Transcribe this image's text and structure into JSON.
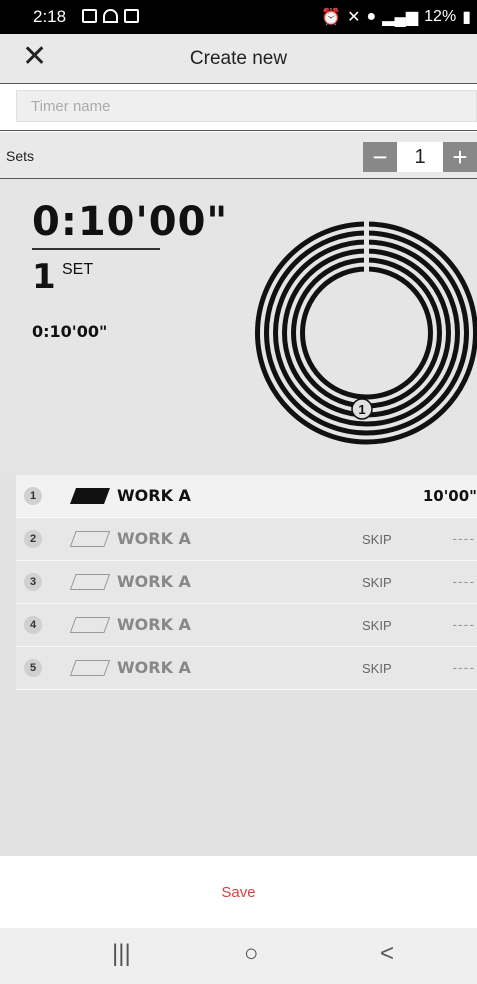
{
  "status_bar": {
    "time": "2:18",
    "battery": "12%"
  },
  "header": {
    "close_glyph": "✕",
    "title": "Create new"
  },
  "timer_name": {
    "placeholder": "Timer name",
    "value": ""
  },
  "sets": {
    "label": "Sets",
    "minus": "−",
    "value": "1",
    "plus": "+"
  },
  "summary": {
    "total_time": "0:10'00\"",
    "set_count": "1",
    "set_word": "SET",
    "set_time": "0:10'00\"",
    "ring_marker": "1"
  },
  "intervals": [
    {
      "num": "1",
      "name": "WORK A",
      "duration": "10'00\"",
      "skip": "",
      "filled": true
    },
    {
      "num": "2",
      "name": "WORK A",
      "duration": "----",
      "skip": "SKIP",
      "filled": false
    },
    {
      "num": "3",
      "name": "WORK A",
      "duration": "----",
      "skip": "SKIP",
      "filled": false
    },
    {
      "num": "4",
      "name": "WORK A",
      "duration": "----",
      "skip": "SKIP",
      "filled": false
    },
    {
      "num": "5",
      "name": "WORK A",
      "duration": "----",
      "skip": "SKIP",
      "filled": false
    }
  ],
  "save_label": "Save",
  "nav": {
    "recent": "|||",
    "home": "○",
    "back": "<"
  },
  "colors": {
    "accent_red": "#d94040",
    "stepper_gray": "#888888"
  }
}
